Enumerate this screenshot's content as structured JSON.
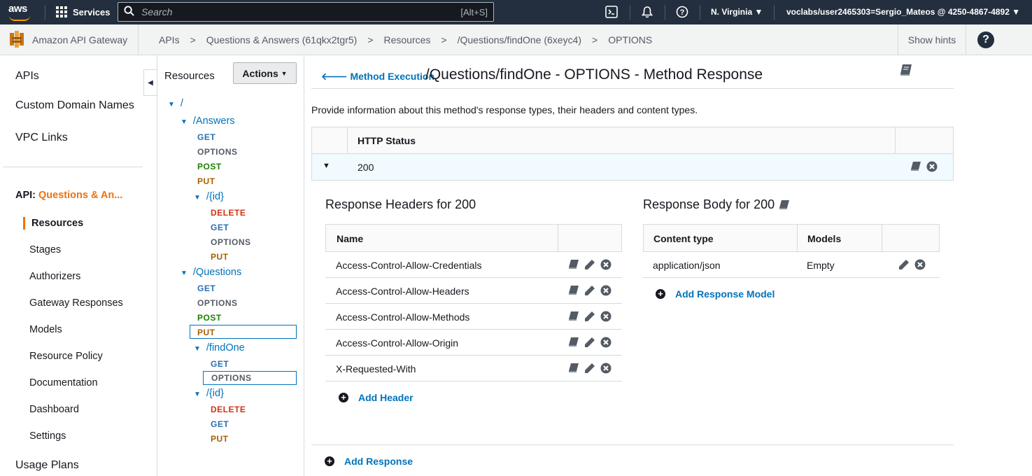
{
  "topnav": {
    "logo": "aws",
    "services_label": "Services",
    "search_placeholder": "Search",
    "search_shortcut": "[Alt+S]",
    "region": "N. Virginia",
    "account": "voclabs/user2465303=Sergio_Mateos @ 4250-4867-4892",
    "icons": [
      "cloudshell-icon",
      "bell-icon",
      "help-circle-icon"
    ]
  },
  "breadcrumb": {
    "service_name": "Amazon API Gateway",
    "items": [
      "APIs",
      "Questions & Answers (61qkx2tgr5)",
      "Resources",
      "/Questions/findOne (6xeyc4)",
      "OPTIONS"
    ],
    "separator": ">",
    "show_hints": "Show hints",
    "help": "?"
  },
  "leftnav": {
    "top_items": [
      "APIs",
      "Custom Domain Names",
      "VPC Links"
    ],
    "api_prefix": "API:",
    "api_name": "Questions & An...",
    "active": "Resources",
    "sub_items": [
      "Stages",
      "Authorizers",
      "Gateway Responses",
      "Models",
      "Resource Policy",
      "Documentation",
      "Dashboard",
      "Settings"
    ],
    "usage_plans": "Usage Plans"
  },
  "tree": {
    "header": "Resources",
    "actions_label": "Actions",
    "nodes": {
      "root": "/",
      "answers": "/Answers",
      "answers_methods": [
        "GET",
        "OPTIONS",
        "POST",
        "PUT"
      ],
      "answers_id": "/{id}",
      "answers_id_methods": [
        "DELETE",
        "GET",
        "OPTIONS",
        "PUT"
      ],
      "questions": "/Questions",
      "questions_methods": [
        "GET",
        "OPTIONS",
        "POST",
        "PUT"
      ],
      "findone": "/findOne",
      "findone_methods": [
        "GET",
        "OPTIONS"
      ],
      "questions_id": "/{id}",
      "questions_id_methods": [
        "DELETE",
        "GET",
        "PUT"
      ]
    }
  },
  "main": {
    "back_label": "Method Execution",
    "title": "/Questions/findOne - OPTIONS - Method Response",
    "description": "Provide information about this method's response types, their headers and content types.",
    "status_table": {
      "header": "HTTP Status",
      "rows": [
        "200"
      ]
    },
    "headers_section": {
      "title": "Response Headers for 200",
      "column": "Name",
      "rows": [
        "Access-Control-Allow-Credentials",
        "Access-Control-Allow-Headers",
        "Access-Control-Allow-Methods",
        "Access-Control-Allow-Origin",
        "X-Requested-With"
      ],
      "add_label": "Add Header"
    },
    "body_section": {
      "title": "Response Body for 200",
      "columns": [
        "Content type",
        "Models"
      ],
      "rows": [
        {
          "content_type": "application/json",
          "model": "Empty"
        }
      ],
      "add_label": "Add Response Model"
    },
    "add_response_label": "Add Response"
  },
  "colors": {
    "nav_bg": "#232f3e",
    "accent_orange": "#ec7211",
    "link_blue": "#0073bb",
    "selected_row": "#f1faff"
  }
}
